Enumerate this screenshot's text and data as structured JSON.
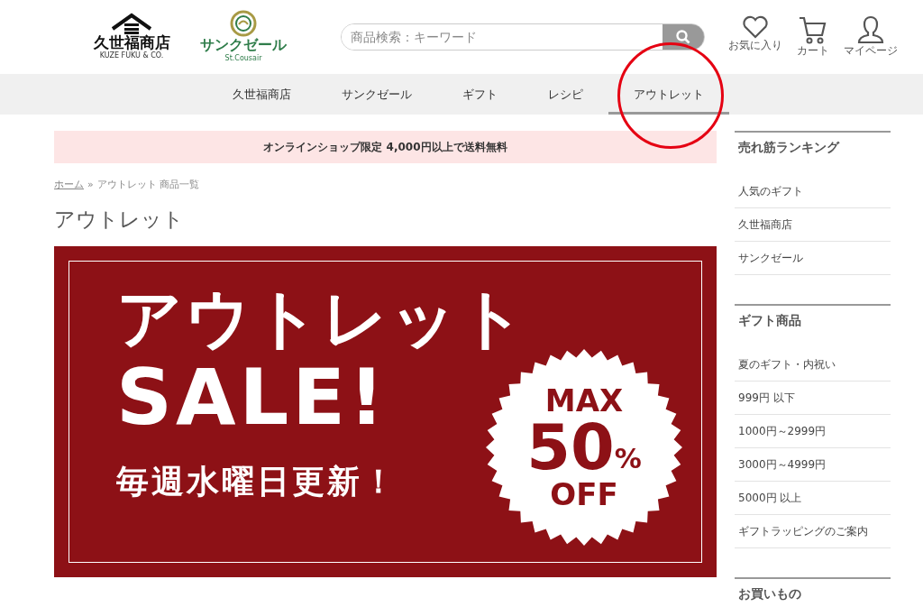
{
  "header": {
    "logos": [
      {
        "kind": "kuze",
        "name": "久世福商店",
        "subtitle": "KUZE FUKU & CO."
      },
      {
        "kind": "cousair",
        "name": "サンクゼール",
        "subtitle": "St.Cousair"
      }
    ],
    "search": {
      "placeholder": "商品検索：キーワード"
    },
    "actions": [
      {
        "kind": "heart",
        "label": "お気に入り"
      },
      {
        "kind": "cart",
        "label": "カート"
      },
      {
        "kind": "person",
        "label": "マイページ"
      }
    ]
  },
  "nav": [
    {
      "label": "久世福商店",
      "selected": false
    },
    {
      "label": "サンクゼール",
      "selected": false
    },
    {
      "label": "ギフト",
      "selected": false
    },
    {
      "label": "レシピ",
      "selected": false
    },
    {
      "label": "アウトレット",
      "selected": true
    }
  ],
  "notice": "オンラインショップ限定 4,000円以上で送料無料",
  "breadcrumb": {
    "home": "ホーム",
    "separator": "»",
    "current": "アウトレット 商品一覧"
  },
  "page_title": "アウトレット",
  "banner": {
    "title": "アウトレット",
    "subtitle": "SALE!",
    "note": "毎週水曜日更新！",
    "badge": {
      "top": "MAX",
      "number": "50",
      "unit": "%",
      "bottom": "OFF"
    }
  },
  "sidebar": [
    {
      "title": "売れ筋ランキング",
      "items": [
        "人気のギフト",
        "久世福商店",
        "サンクゼール"
      ]
    },
    {
      "title": "ギフト商品",
      "items": [
        "夏のギフト・内祝い",
        "999円 以下",
        "1000円～2999円",
        "3000円～4999円",
        "5000円 以上",
        "ギフトラッピングのご案内"
      ]
    },
    {
      "title": "お買いもの"
    }
  ]
}
